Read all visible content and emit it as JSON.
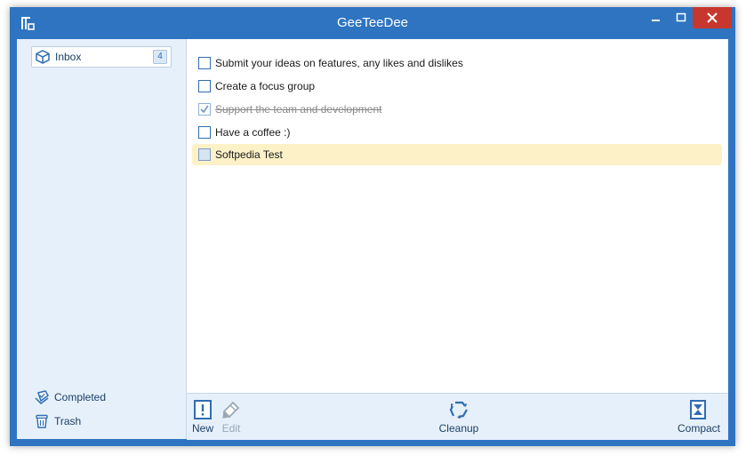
{
  "window": {
    "title": "GeeTeeDee"
  },
  "sidebar": {
    "inbox": {
      "label": "Inbox",
      "count": "4"
    },
    "completed": {
      "label": "Completed"
    },
    "trash": {
      "label": "Trash"
    }
  },
  "tasks": [
    {
      "text": "Submit your ideas on features, any likes and dislikes",
      "checked": false,
      "highlighted": false
    },
    {
      "text": "Create a focus group",
      "checked": false,
      "highlighted": false
    },
    {
      "text": "Support the team and development",
      "checked": true,
      "highlighted": false
    },
    {
      "text": "Have a coffee :)",
      "checked": false,
      "highlighted": false
    },
    {
      "text": "Softpedia Test",
      "checked": false,
      "highlighted": true
    }
  ],
  "toolbar": {
    "new_label": "New",
    "edit_label": "Edit",
    "cleanup_label": "Cleanup",
    "compact_label": "Compact"
  },
  "colors": {
    "titlebar": "#2f74c0",
    "sidebar": "#e6f0fa",
    "accent": "#2f6db3",
    "highlight": "#fdf1c7",
    "close": "#c7372e"
  }
}
